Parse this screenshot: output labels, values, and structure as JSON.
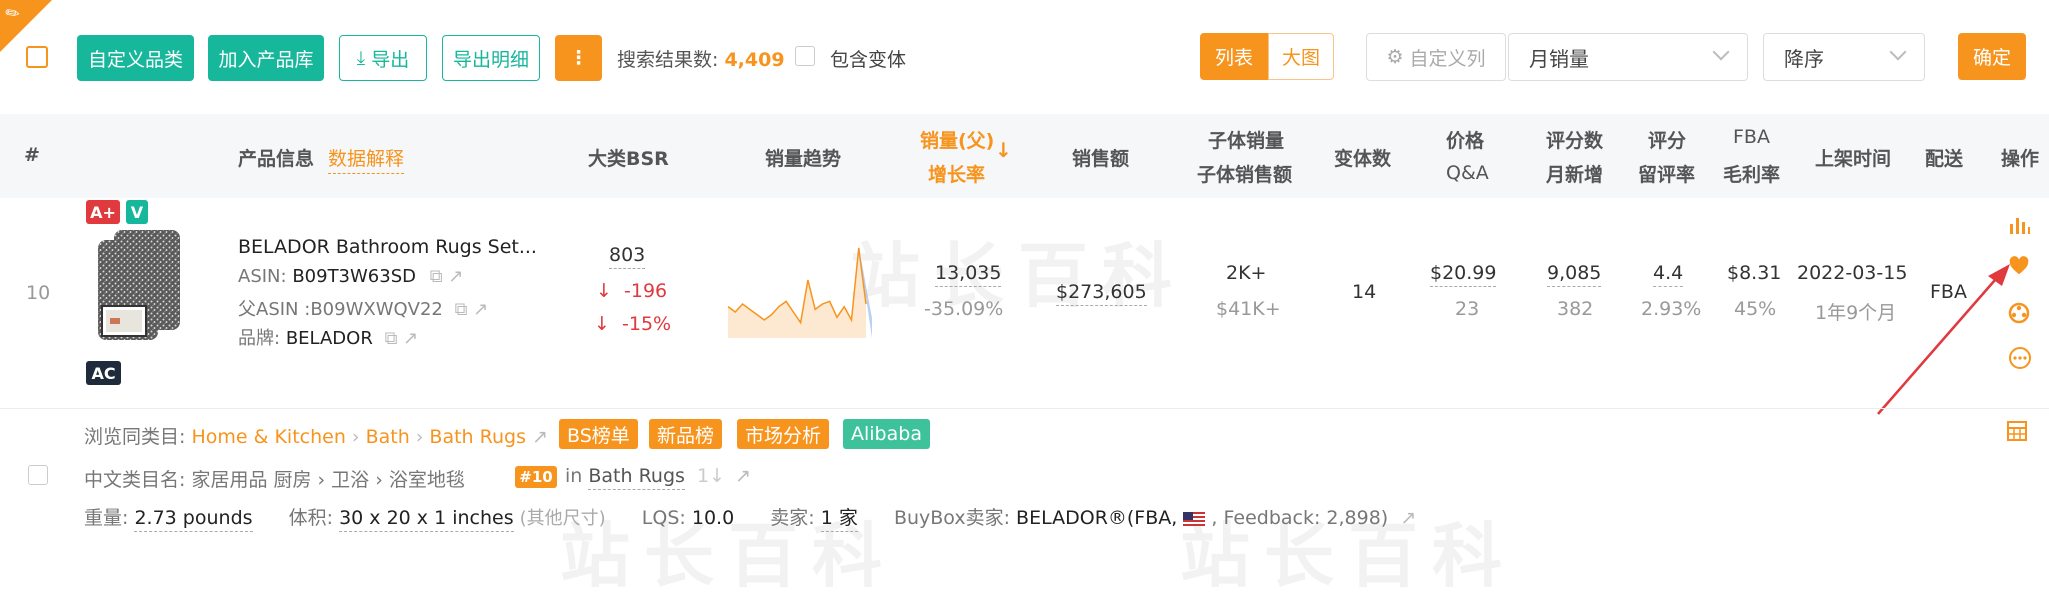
{
  "toolbar": {
    "custom_category": "自定义品类",
    "add_library": "加入产品库",
    "export": "导出",
    "export_detail": "导出明细",
    "more": "⋮",
    "result_label": "搜索结果数:",
    "result_count": "4,409",
    "include_variants": "包含变体",
    "view_list": "列表",
    "view_grid": "大图",
    "custom_columns": "自定义列",
    "sort_field": "月销量",
    "sort_order": "降序",
    "confirm": "确定"
  },
  "columns": {
    "index": "#",
    "product_info": "产品信息",
    "data_explain": "数据解释",
    "bsr": "大类BSR",
    "trend": "销量趋势",
    "sales_parent": "销量(父)",
    "growth": "增长率",
    "revenue": "销售额",
    "child_sales": "子体销量",
    "child_revenue": "子体销售额",
    "variants": "变体数",
    "price": "价格",
    "qa": "Q&A",
    "ratings": "评分数",
    "monthly_new": "月新增",
    "rating": "评分",
    "review_rate": "留评率",
    "fba": "FBA",
    "margin": "毛利率",
    "listed": "上架时间",
    "delivery": "配送",
    "action": "操作"
  },
  "product": {
    "index": "10",
    "badge_aplus": "A+",
    "badge_v": "V",
    "badge_ac": "AC",
    "title": "BELADOR Bathroom Rugs Set...",
    "asin_label": "ASIN:",
    "asin": "B09T3W63SD",
    "parent_asin_label": "父ASIN :",
    "parent_asin": "B09WXWQV22",
    "brand_label": "品牌:",
    "brand": "BELADOR",
    "bsr": "803",
    "bsr_change": "-196",
    "bsr_change_pct": "-15%",
    "sales": "13,035",
    "growth": "-35.09%",
    "revenue": "$273,605",
    "child_sales": "2K+",
    "child_revenue": "$41K+",
    "variants": "14",
    "price": "$20.99",
    "qa": "23",
    "ratings": "9,085",
    "monthly_new": "382",
    "rating": "4.4",
    "review_rate": "2.93%",
    "fba_fee": "$8.31",
    "margin": "45%",
    "listed_date": "2022-03-15",
    "listed_age": "1年9个月",
    "delivery": "FBA"
  },
  "trend": {
    "values": [
      8,
      6,
      9,
      7,
      5,
      3,
      5,
      8,
      10,
      6,
      2,
      18,
      7,
      9,
      10,
      4,
      8,
      3,
      30,
      9
    ],
    "color": "#f7941d"
  },
  "details": {
    "browse_label": "浏览同类目:",
    "crumb1": "Home & Kitchen",
    "crumb2": "Bath",
    "crumb3": "Bath Rugs",
    "tag_bs": "BS榜单",
    "tag_new": "新品榜",
    "tag_market": "市场分析",
    "tag_alibaba": "Alibaba",
    "cn_label": "中文类目名:",
    "cn_category": "家居用品 厨房 › 卫浴 › 浴室地毯",
    "rank_badge": "#10",
    "rank_in": "in",
    "rank_category": "Bath Rugs",
    "rank_trend": "1↓",
    "weight_label": "重量:",
    "weight": "2.73 pounds",
    "size_label": "体积:",
    "size": "30 x 20 x 1 inches",
    "size_other": "(其他尺寸)",
    "lqs_label": "LQS:",
    "lqs": "10.0",
    "sellers_label": "卖家:",
    "sellers": "1 家",
    "buybox_label": "BuyBox卖家:",
    "buybox_seller": "BELADOR®(FBA,",
    "feedback": ", Feedback: 2,898)"
  },
  "watermark": "站长百科",
  "colors": {
    "accent": "#f7941d",
    "teal": "#17b79b",
    "red": "#e0393e"
  }
}
